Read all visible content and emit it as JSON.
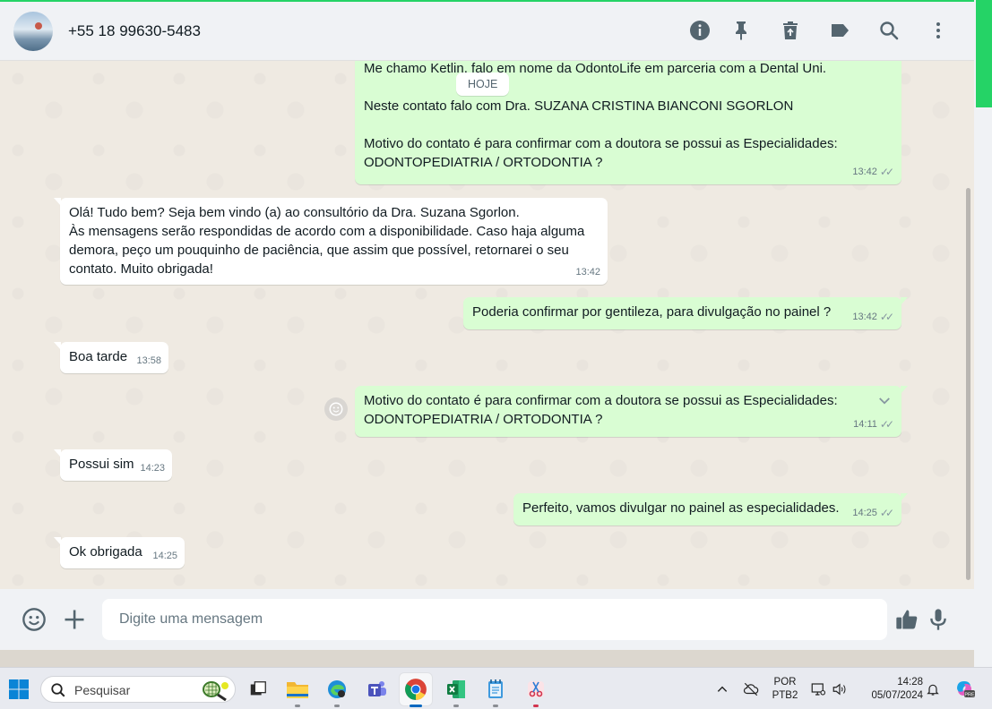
{
  "header": {
    "contact_name": "+55 18 99630-5483",
    "icons": [
      "info-icon",
      "pin-icon",
      "delete-icon",
      "label-icon",
      "search-icon",
      "menu-icon"
    ]
  },
  "chat": {
    "date_chip": "HOJE",
    "messages": [
      {
        "direction": "out",
        "text": "Me chamo Ketlin, falo em nome da OdontoLife em parceria com a Dental Uni.\n\nNeste contato falo com Dra. SUZANA CRISTINA BIANCONI SGORLON\n\nMotivo do contato é para confirmar com a doutora se possui as Especialidades:\nODONTOPEDIATRIA / ORTODONTIA ?",
        "time": "13:42",
        "status": "read"
      },
      {
        "direction": "in",
        "text": "Olá! Tudo bem? Seja bem vindo (a) ao consultório da Dra. Suzana Sgorlon.\nÀs mensagens serão respondidas de acordo com a disponibilidade. Caso haja alguma\ndemora, peço um pouquinho de paciência, que assim que possível, retornarei o seu\ncontato. Muito obrigada!",
        "time": "13:42"
      },
      {
        "direction": "out",
        "text": "Poderia confirmar por gentileza, para divulgação no painel ?",
        "time": "13:42",
        "status": "read"
      },
      {
        "direction": "in",
        "text": "Boa tarde",
        "time": "13:58"
      },
      {
        "direction": "out",
        "text": "Motivo do contato é para confirmar com a doutora se possui as Especialidades:\nODONTOPEDIATRIA / ORTODONTIA ?",
        "time": "14:11",
        "status": "read"
      },
      {
        "direction": "in",
        "text": "Possui sim",
        "time": "14:23"
      },
      {
        "direction": "out",
        "text": "Perfeito, vamos divulgar no painel as especialidades.",
        "time": "14:25",
        "status": "read"
      },
      {
        "direction": "in",
        "text": "Ok obrigada",
        "time": "14:25"
      }
    ]
  },
  "composer": {
    "placeholder": "Digite uma mensagem",
    "icons": [
      "emoji-icon",
      "attach-plus-icon",
      "thumbs-up-icon",
      "microphone-icon"
    ]
  },
  "taskbar": {
    "search_placeholder": "Pesquisar",
    "apps": [
      "task-view",
      "file-explorer",
      "edge",
      "teams",
      "chrome",
      "excel",
      "notepad",
      "snipping-tool"
    ],
    "active_app": "chrome",
    "language_line1": "POR",
    "language_line2": "PTB2",
    "time": "14:28",
    "date": "05/07/2024",
    "colors": {
      "whatsapp_green": "#25d366",
      "outgoing_bubble": "#d9fdd3",
      "chat_bg": "#efeae2",
      "accent": "#0067c0"
    }
  }
}
